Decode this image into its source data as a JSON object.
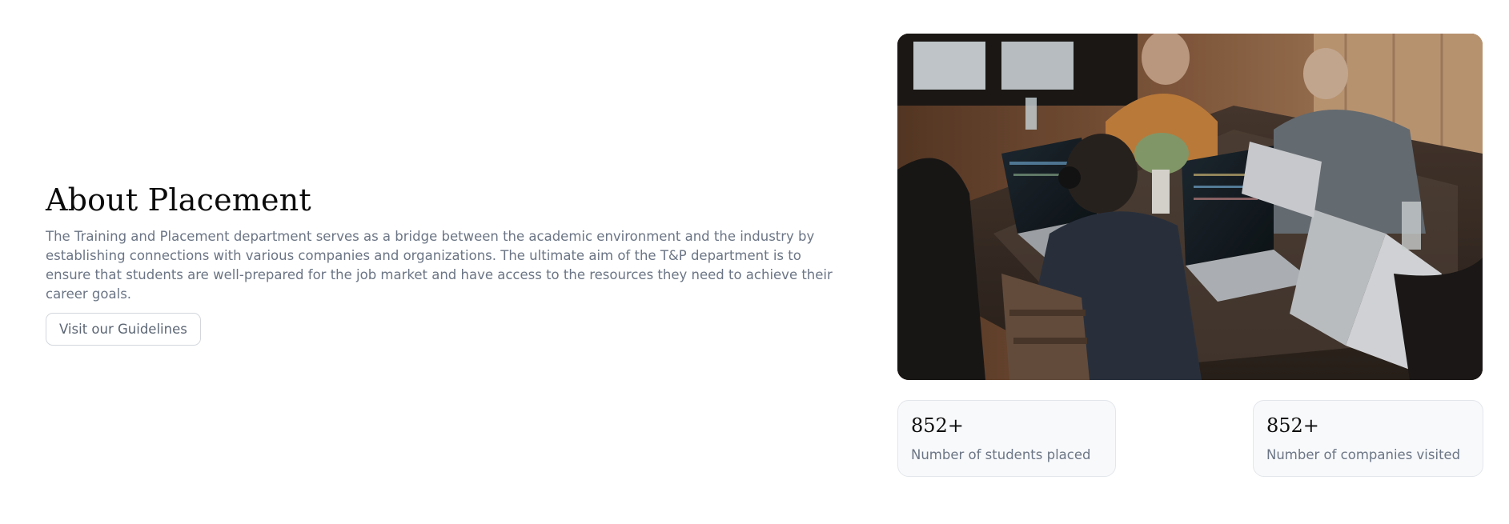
{
  "about": {
    "title": "About Placement",
    "description": "The Training and Placement department serves as a bridge between the academic environment and the industry by establishing connections with various companies and organizations. The ultimate aim of the T&P department is to ensure that students are well-prepared for the job market and have access to the resources they need to achieve their career goals.",
    "button_label": "Visit our Guidelines"
  },
  "stats": [
    {
      "value": "852+",
      "label": "Number of students placed"
    },
    {
      "value": "852+",
      "label": "Number of companies visited"
    }
  ],
  "colors": {
    "heading": "#0b0b0b",
    "body_text": "#6b7585",
    "card_background": "#f8f9fb",
    "card_border": "#e3e6ea"
  }
}
